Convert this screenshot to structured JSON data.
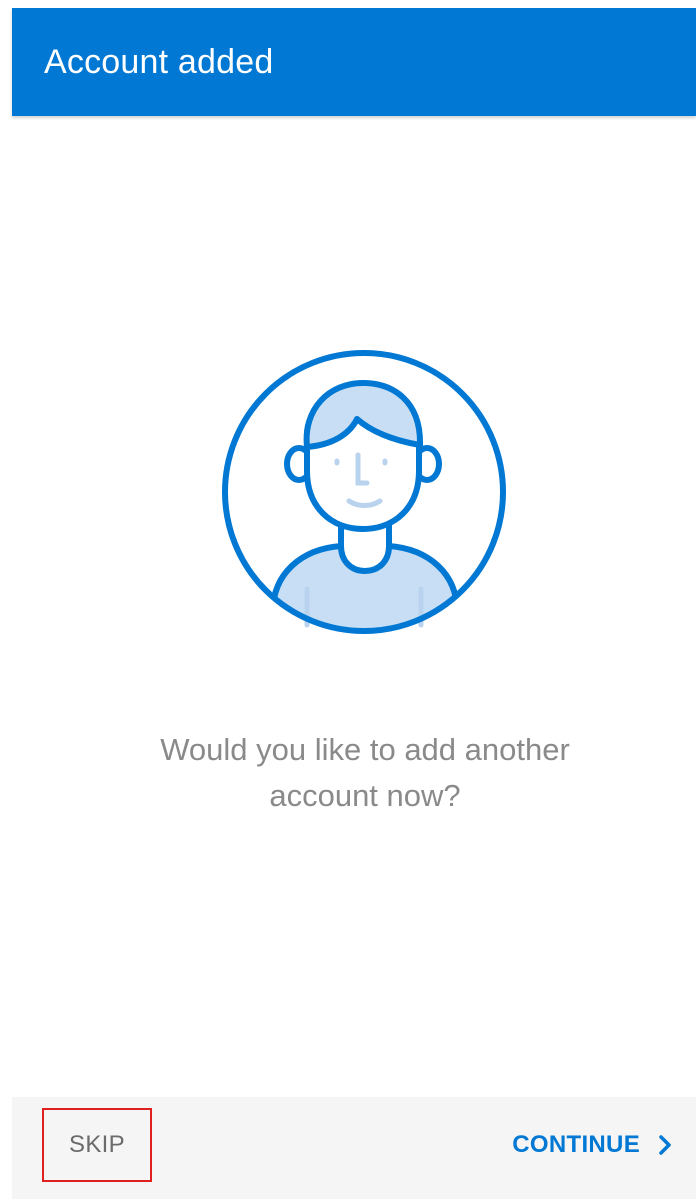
{
  "header": {
    "title": "Account added"
  },
  "illustration": {
    "icon": "person-avatar-icon"
  },
  "prompt": {
    "line1": "Would you like to add another",
    "line2": "account now?"
  },
  "footer": {
    "skip_label": "SKIP",
    "continue_label": "CONTINUE",
    "continue_icon": "chevron-right-icon"
  },
  "colors": {
    "brand": "#0078d4",
    "highlight_box": "#e0201e",
    "prompt_text": "#8a8a8a",
    "footer_background": "#f5f5f5"
  }
}
